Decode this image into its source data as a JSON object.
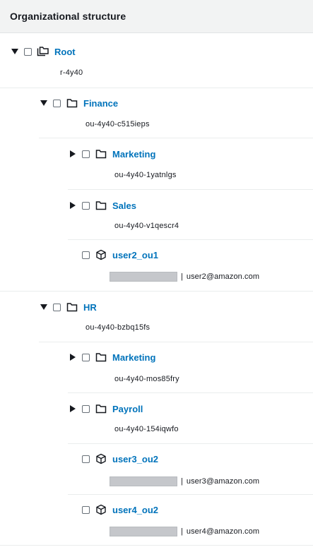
{
  "header": {
    "title": "Organizational structure"
  },
  "tree": {
    "root": {
      "name": "Root",
      "id": "r-4y40"
    },
    "finance": {
      "name": "Finance",
      "id": "ou-4y40-c515ieps"
    },
    "finance_marketing": {
      "name": "Marketing",
      "id": "ou-4y40-1yatnlgs"
    },
    "finance_sales": {
      "name": "Sales",
      "id": "ou-4y40-v1qescr4"
    },
    "user2_ou1": {
      "name": "user2_ou1",
      "separator": "|",
      "email": "user2@amazon.com"
    },
    "hr": {
      "name": "HR",
      "id": "ou-4y40-bzbq15fs"
    },
    "hr_marketing": {
      "name": "Marketing",
      "id": "ou-4y40-mos85fry"
    },
    "hr_payroll": {
      "name": "Payroll",
      "id": "ou-4y40-154iqwfo"
    },
    "user3_ou2": {
      "name": "user3_ou2",
      "separator": "|",
      "email": "user3@amazon.com"
    },
    "user4_ou2": {
      "name": "user4_ou2",
      "separator": "|",
      "email": "user4@amazon.com"
    }
  },
  "icons": {
    "expanded": "caret-down-icon",
    "collapsed": "caret-right-icon",
    "root": "root-folders-icon",
    "ou": "folder-icon",
    "account": "account-cube-icon"
  },
  "colors": {
    "link": "#0073bb",
    "header_bg": "#f2f3f3",
    "redacted": "#c5c7cb"
  }
}
